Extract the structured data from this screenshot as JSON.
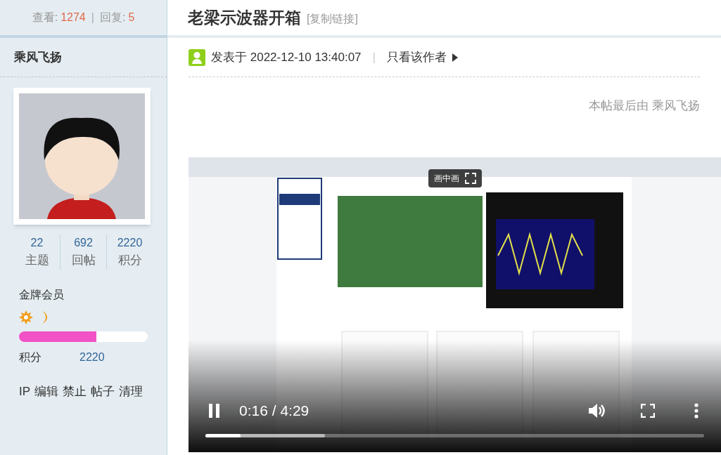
{
  "stats": {
    "views_label": "查看:",
    "views": "1274",
    "sep": "|",
    "replies_label": "回复:",
    "replies": "5"
  },
  "thread": {
    "title": "老梁示波器开箱",
    "copy_link": "[复制链接]"
  },
  "author": {
    "name": "乘风飞扬",
    "counts": [
      {
        "value": "22",
        "label": "主题"
      },
      {
        "value": "692",
        "label": "回帖"
      },
      {
        "value": "2220",
        "label": "积分"
      }
    ],
    "rank": "金牌会员",
    "progress": {
      "level": 0.6
    },
    "points_label": "积分",
    "points": "2220",
    "actions": [
      "IP",
      "编辑",
      "禁止",
      "帖子",
      "清理"
    ]
  },
  "post": {
    "posted": "发表于 2022-12-10 13:40:07",
    "sep": "|",
    "only_author": "只看该作者",
    "edit_note": "本帖最后由 乘风飞扬",
    "video": {
      "pip": "画中画",
      "playing": true,
      "time": "0:16 / 4:29",
      "played": {
        "level": 0.07
      },
      "buffered": {
        "level": 0.24
      }
    }
  }
}
